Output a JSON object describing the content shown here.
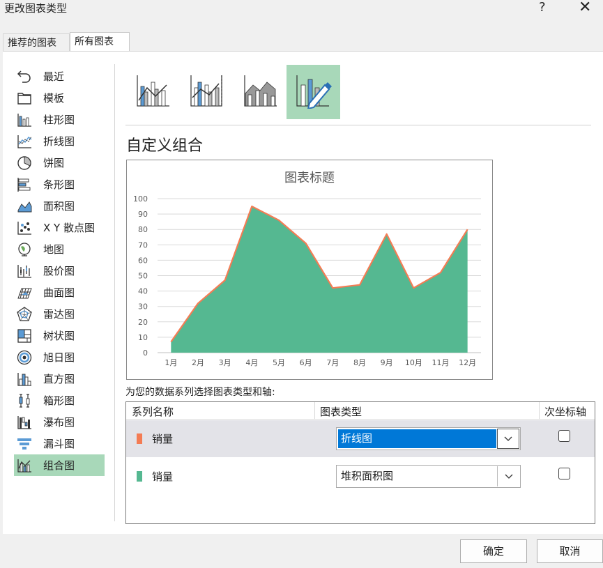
{
  "window": {
    "title": "更改图表类型",
    "help": "?",
    "close": "✕"
  },
  "tabs": [
    {
      "label": "推荐的图表",
      "selected": false
    },
    {
      "label": "所有图表",
      "selected": true
    }
  ],
  "sidebar": {
    "items": [
      {
        "label": "最近",
        "icon": "undo-icon"
      },
      {
        "label": "模板",
        "icon": "folder-icon"
      },
      {
        "label": "柱形图",
        "icon": "column-chart-icon"
      },
      {
        "label": "折线图",
        "icon": "line-chart-icon"
      },
      {
        "label": "饼图",
        "icon": "pie-chart-icon"
      },
      {
        "label": "条形图",
        "icon": "bar-chart-icon"
      },
      {
        "label": "面积图",
        "icon": "area-chart-icon"
      },
      {
        "label": "X Y 散点图",
        "icon": "scatter-chart-icon"
      },
      {
        "label": "地图",
        "icon": "globe-icon"
      },
      {
        "label": "股价图",
        "icon": "stock-chart-icon"
      },
      {
        "label": "曲面图",
        "icon": "surface-chart-icon"
      },
      {
        "label": "雷达图",
        "icon": "radar-chart-icon"
      },
      {
        "label": "树状图",
        "icon": "treemap-icon"
      },
      {
        "label": "旭日图",
        "icon": "sunburst-icon"
      },
      {
        "label": "直方图",
        "icon": "histogram-icon"
      },
      {
        "label": "箱形图",
        "icon": "box-whisker-icon"
      },
      {
        "label": "瀑布图",
        "icon": "waterfall-icon"
      },
      {
        "label": "漏斗图",
        "icon": "funnel-icon"
      },
      {
        "label": "组合图",
        "icon": "combo-chart-icon",
        "selected": true
      }
    ]
  },
  "subtypes": [
    {
      "icon": "clustered-column-line-icon",
      "selected": false
    },
    {
      "icon": "clustered-column-line-secondary-axis-icon",
      "selected": false
    },
    {
      "icon": "stacked-area-clustered-column-icon",
      "selected": false
    },
    {
      "icon": "custom-combination-icon",
      "selected": true
    }
  ],
  "main": {
    "heading": "自定义组合",
    "caption": "为您的数据系列选择图表类型和轴:"
  },
  "colors": {
    "area_fill": "#55b891",
    "line_stroke": "#f47c54",
    "selection": "#a8d8b9",
    "combo_highlight": "#0078d7"
  },
  "chart_data": {
    "type": "area",
    "title": "图表标题",
    "categories": [
      "1月",
      "2月",
      "3月",
      "4月",
      "5月",
      "6月",
      "7月",
      "8月",
      "9月",
      "10月",
      "11月",
      "12月"
    ],
    "series": [
      {
        "name": "销量",
        "chart_type": "line",
        "color": "#f47c54",
        "values": [
          7,
          32,
          47,
          95,
          86,
          71,
          42,
          44,
          77,
          42,
          52,
          80
        ]
      },
      {
        "name": "销量",
        "chart_type": "stacked-area",
        "color": "#55b891",
        "values": [
          7,
          32,
          47,
          95,
          86,
          71,
          42,
          44,
          77,
          42,
          52,
          80
        ]
      }
    ],
    "ylim": [
      0,
      100
    ],
    "yticks": [
      "0",
      "10",
      "20",
      "30",
      "40",
      "50",
      "60",
      "70",
      "80",
      "90",
      "100"
    ],
    "grid": true,
    "legend": "none"
  },
  "series_table": {
    "headers": {
      "name": "系列名称",
      "type": "图表类型",
      "secondary": "次坐标轴"
    },
    "rows": [
      {
        "name": "销量",
        "color": "#f47c54",
        "chart_type": "折线图",
        "secondary_axis": false,
        "active": true
      },
      {
        "name": "销量",
        "color": "#55b891",
        "chart_type": "堆积面积图",
        "secondary_axis": false,
        "active": false
      }
    ]
  },
  "buttons": {
    "ok": "确定",
    "cancel": "取消"
  }
}
